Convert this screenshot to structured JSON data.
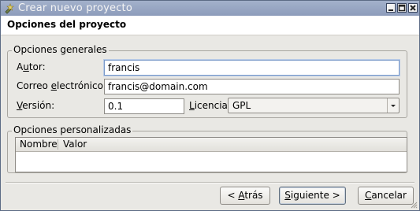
{
  "window": {
    "title": "Crear nuevo proyecto"
  },
  "header": {
    "title": "Opciones del proyecto"
  },
  "general": {
    "legend": "Opciones generales",
    "author": {
      "label_pre": "A",
      "label_u": "u",
      "label_post": "tor:",
      "value": "francis"
    },
    "email": {
      "label_pre": "Correo ",
      "label_u": "e",
      "label_post": "lectrónico:",
      "value": "francis@domain.com"
    },
    "version": {
      "label_pre": "",
      "label_u": "V",
      "label_post": "ersión:",
      "value": "0.1"
    },
    "license": {
      "label_pre": "",
      "label_u": "L",
      "label_post": "icencia:",
      "value": "GPL"
    }
  },
  "custom": {
    "legend": "Opciones personalizadas",
    "columns": [
      "Nombre",
      "Valor"
    ]
  },
  "buttons": {
    "back": {
      "pre": "< ",
      "u": "A",
      "post": "trás"
    },
    "next": {
      "pre": "",
      "u": "S",
      "post": "iguiente >"
    },
    "cancel": {
      "pre": "",
      "u": "C",
      "post": "ancelar"
    }
  },
  "colors": {
    "titlebar": "#95a4c2",
    "accent": "#7a99c9"
  }
}
